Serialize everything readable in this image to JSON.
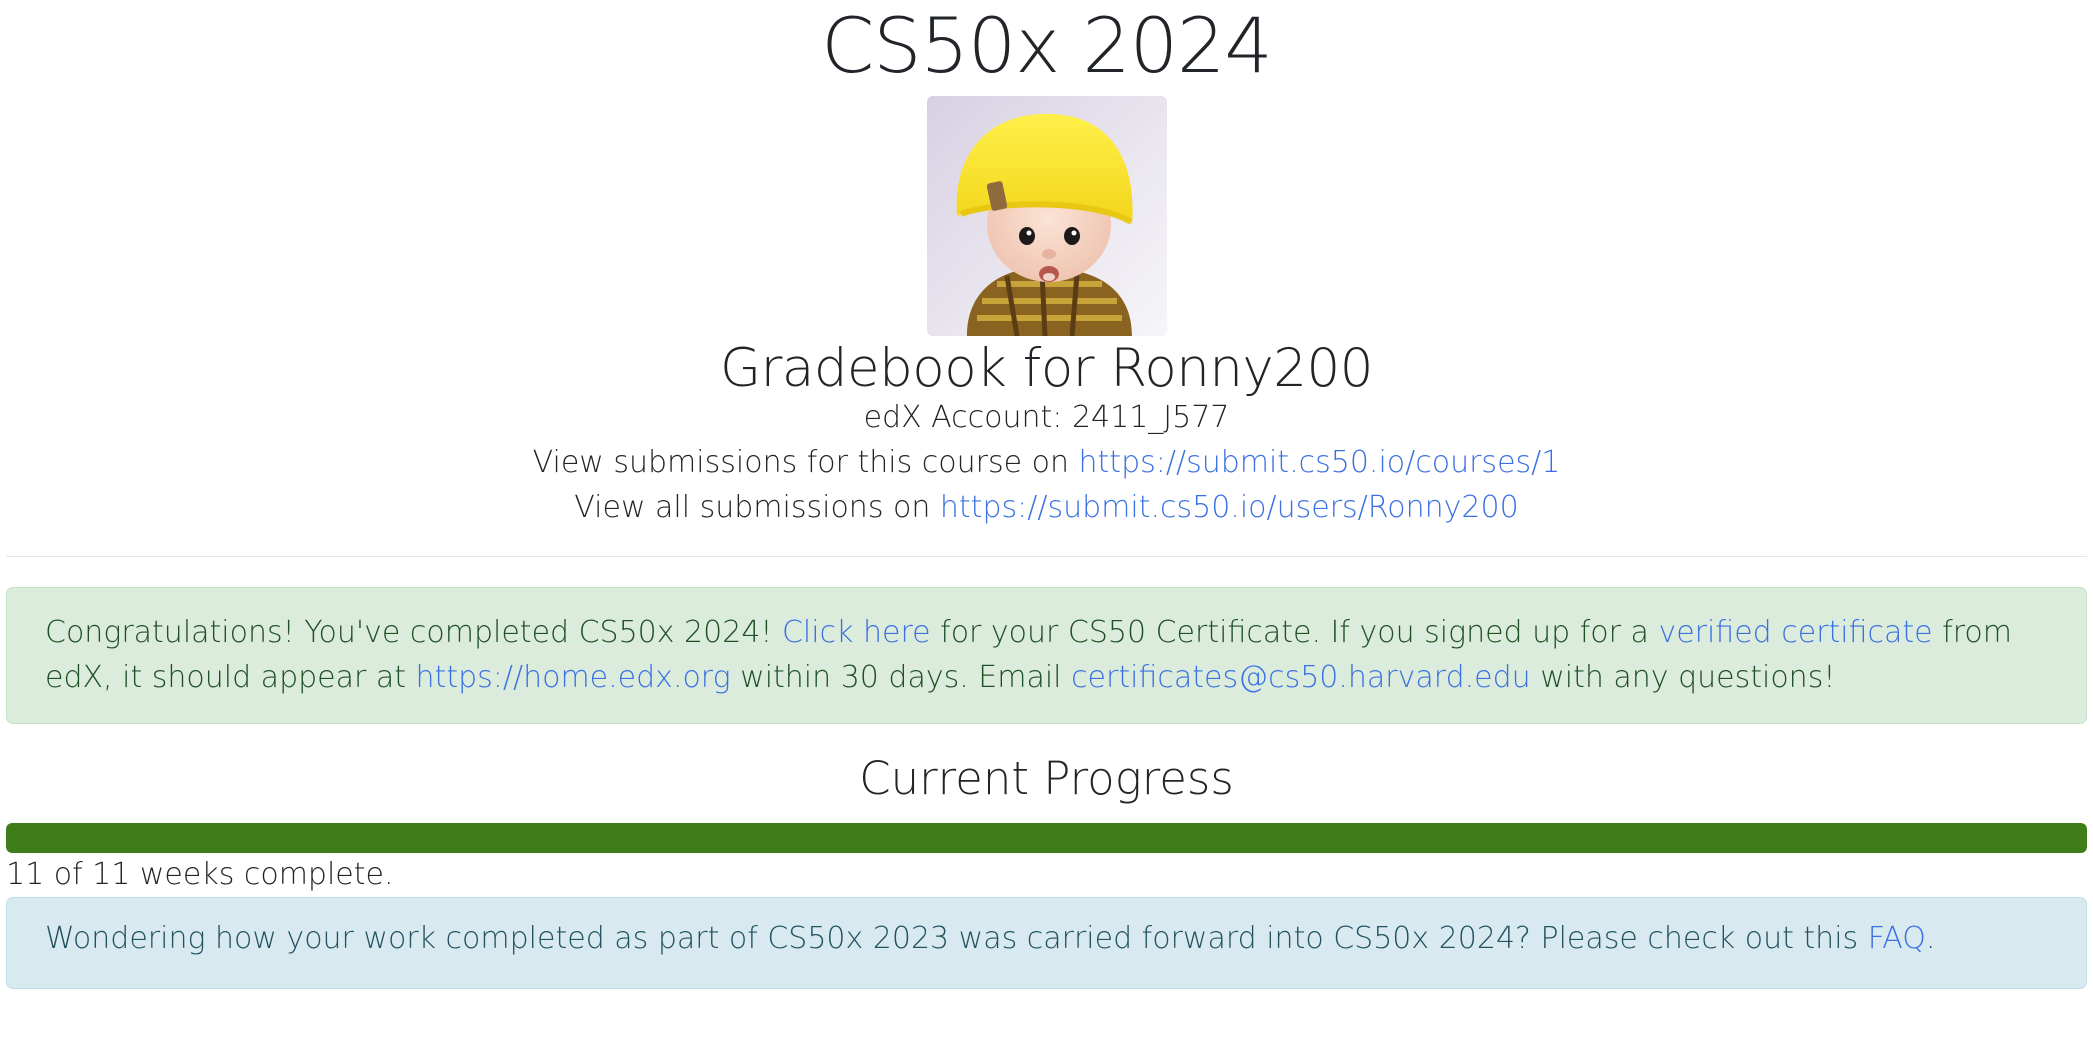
{
  "header": {
    "course_title": "CS50x 2024",
    "gradebook_title": "Gradebook for Ronny200"
  },
  "account": {
    "edx_account_line": "edX Account: 2411_J577",
    "course_submissions_prefix": "View submissions for this course on ",
    "course_submissions_link": "https://submit.cs50.io/courses/1",
    "all_submissions_prefix": "View all submissions on ",
    "all_submissions_link": "https://submit.cs50.io/users/Ronny200"
  },
  "congrats_alert": {
    "part1": "Congratulations! You've completed CS50x 2024! ",
    "click_here_link": "Click here",
    "part2": " for your CS50 Certificate. If you signed up for a ",
    "verified_cert_link": "verified certificate",
    "part3": " from edX, it should appear at ",
    "edx_link": "https://home.edx.org",
    "part4": " within 30 days. Email ",
    "email_link": "certificates@cs50.harvard.edu",
    "part5": " with any questions!"
  },
  "progress": {
    "title": "Current Progress",
    "weeks_complete": 11,
    "weeks_total": 11,
    "fraction": 1.0,
    "status_text": "11 of 11 weeks complete.",
    "bar_color": "#3e7d18"
  },
  "info_alert": {
    "text": "Wondering how your work completed as part of CS50x 2023 was carried forward into CS50x 2024? Please check out this ",
    "faq_link": "FAQ",
    "end": "."
  },
  "colors": {
    "link": "#3a70e3",
    "success_bg": "#dcecdc",
    "info_bg": "#d8eaf0"
  }
}
